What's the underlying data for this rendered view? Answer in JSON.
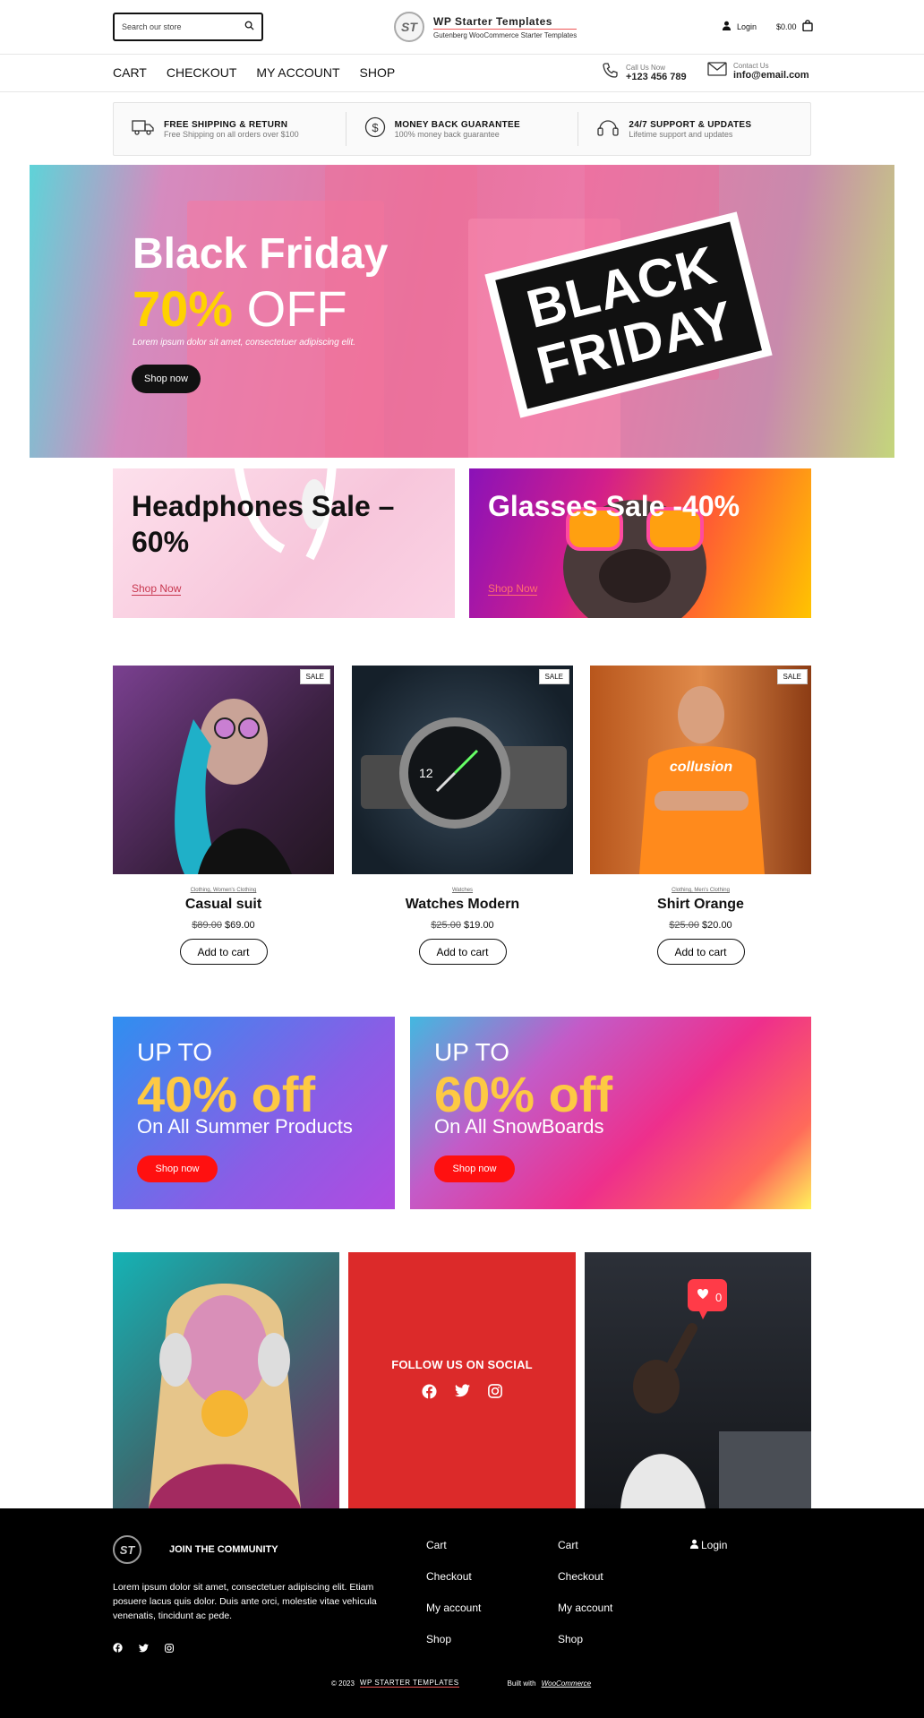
{
  "header": {
    "search_placeholder": "Search our store",
    "site_title": "WP Starter Templates",
    "site_subtitle": "Gutenberg WooCommerce Starter Templates",
    "logo_text": "ST",
    "login": "Login",
    "cart_total": "$0.00"
  },
  "nav": {
    "items": [
      "CART",
      "CHECKOUT",
      "MY ACCOUNT",
      "SHOP"
    ],
    "call_label": "Call Us Now",
    "call_value": "+123 456 789",
    "email_label": "Contact Us",
    "email_value": "info@email.com"
  },
  "features": [
    {
      "title": "FREE SHIPPING & RETURN",
      "sub": "Free Shipping on all orders over $100",
      "icon": "truck-icon"
    },
    {
      "title": "MONEY BACK GUARANTEE",
      "sub": "100% money back guarantee",
      "icon": "dollar-icon"
    },
    {
      "title": "24/7 SUPPORT & UPDATES",
      "sub": "Lifetime support and updates",
      "icon": "support-icon"
    }
  ],
  "hero": {
    "title": "Black Friday",
    "percent": "70%",
    "off": "OFF",
    "text": "Lorem ipsum dolor sit amet, consectetuer adipiscing elit.",
    "button": "Shop now",
    "badge_line1": "BLACK",
    "badge_line2": "FRIDAY"
  },
  "promos": [
    {
      "title": "Headphones Sale – 60%",
      "link": "Shop Now"
    },
    {
      "title": "Glasses Sale -40%",
      "link": "Shop Now"
    }
  ],
  "products": [
    {
      "cats": "Clothing, Women's Clothing",
      "name": "Casual suit",
      "old": "$89.00",
      "new": "$69.00",
      "badge": "SALE",
      "button": "Add to cart"
    },
    {
      "cats": "Watches",
      "name": "Watches Modern",
      "old": "$25.00",
      "new": "$19.00",
      "badge": "SALE",
      "button": "Add to cart"
    },
    {
      "cats": "Clothing, Men's Clothing",
      "name": "Shirt Orange",
      "old": "$25.00",
      "new": "$20.00",
      "badge": "SALE",
      "button": "Add to cart"
    }
  ],
  "product_extra": {
    "shirt_text": "collusion"
  },
  "banners": [
    {
      "upto": "UP TO",
      "pct": "40% off",
      "on": "On All Summer Products",
      "button": "Shop now"
    },
    {
      "upto": "UP TO",
      "pct": "60% off",
      "on": "On All SnowBoards",
      "button": "Shop now"
    }
  ],
  "social": {
    "title": "FOLLOW US ON SOCIAL",
    "like_count": "0"
  },
  "footer": {
    "join": "JOIN THE COMMUNITY",
    "text": "Lorem ipsum dolor sit amet, consectetuer adipiscing elit. Etiam posuere lacus quis dolor. Duis ante orci, molestie vitae vehicula venenatis, tincidunt ac pede.",
    "col1": [
      "Cart",
      "Checkout",
      "My account",
      "Shop"
    ],
    "col2": [
      "Cart",
      "Checkout",
      "My account",
      "Shop"
    ],
    "login": "Login",
    "copyright": "© 2023",
    "brand": "WP STARTER TEMPLATES",
    "built": "Built with",
    "woo": "WooCommerce"
  }
}
